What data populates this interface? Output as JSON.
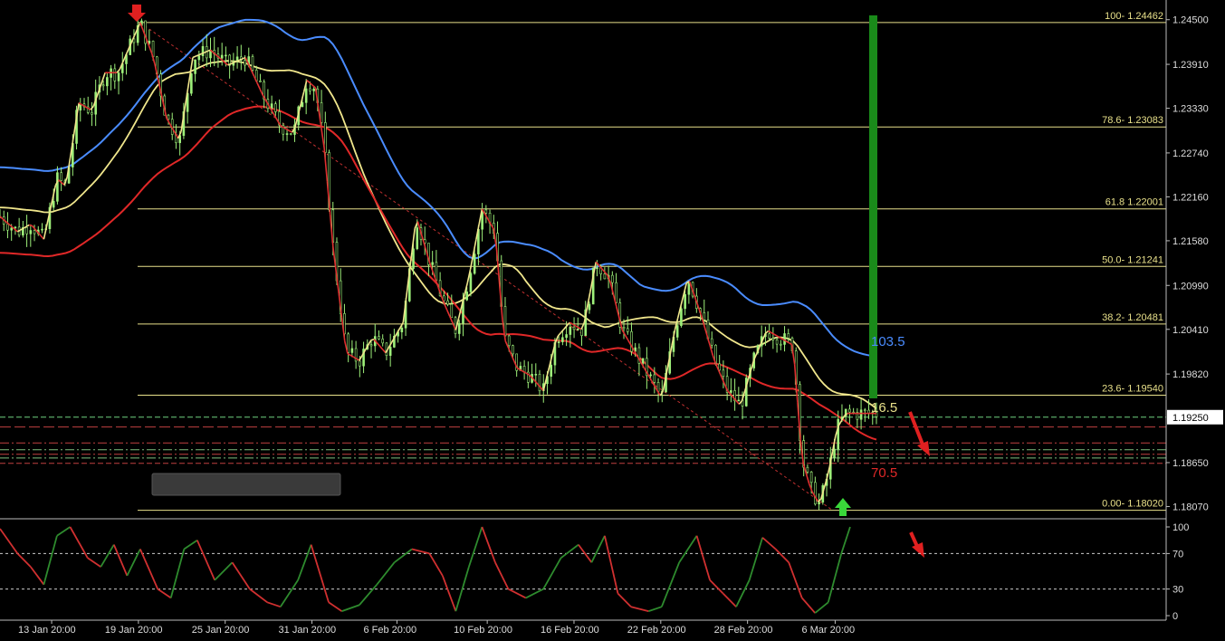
{
  "chart_data": {
    "type": "candlestick",
    "price_axis": {
      "ticks": [
        "1.24500",
        "1.23910",
        "1.23330",
        "1.22740",
        "1.22160",
        "1.21580",
        "1.20990",
        "1.20410",
        "1.19820",
        "1.18650",
        "1.18070"
      ],
      "current_price": "1.19250",
      "range": [
        1.1792,
        1.247
      ]
    },
    "time_axis": {
      "ticks": [
        "13 Jan 20:00",
        "19 Jan 20:00",
        "25 Jan 20:00",
        "31 Jan 20:00",
        "6 Feb 20:00",
        "10 Feb 20:00",
        "16 Feb 20:00",
        "22 Feb 20:00",
        "28 Feb 20:00",
        "6 Mar 20:00"
      ]
    },
    "fibonacci_levels": [
      {
        "label": "100- 1.24462",
        "price": 1.24462
      },
      {
        "label": "78.6- 1.23083",
        "price": 1.23083
      },
      {
        "label": "61.8 1.22001",
        "price": 1.22001
      },
      {
        "label": "50.0- 1.21241",
        "price": 1.21241
      },
      {
        "label": "38.2- 1.20481",
        "price": 1.20481
      },
      {
        "label": "23.6- 1.19540",
        "price": 1.1954
      },
      {
        "label": "0.00- 1.18020",
        "price": 1.1802
      }
    ],
    "moving_average_labels": [
      {
        "text": "103.5",
        "color": "#4a8cff"
      },
      {
        "text": "16.5",
        "color": "#e8e08a"
      },
      {
        "text": "70.5",
        "color": "#e02828"
      }
    ],
    "horizontal_levels": [
      1.1925,
      1.1912,
      1.1891,
      1.1882,
      1.1876,
      1.1871,
      1.1864
    ],
    "price_series_approx": [
      [
        0.0,
        1.219
      ],
      [
        0.02,
        1.217
      ],
      [
        0.035,
        1.218
      ],
      [
        0.05,
        1.216
      ],
      [
        0.065,
        1.224
      ],
      [
        0.075,
        1.223
      ],
      [
        0.09,
        1.234
      ],
      [
        0.105,
        1.233
      ],
      [
        0.12,
        1.238
      ],
      [
        0.135,
        1.238
      ],
      [
        0.15,
        1.242
      ],
      [
        0.16,
        1.2446
      ],
      [
        0.175,
        1.24
      ],
      [
        0.19,
        1.232
      ],
      [
        0.205,
        1.229
      ],
      [
        0.22,
        1.24
      ],
      [
        0.24,
        1.241
      ],
      [
        0.26,
        1.239
      ],
      [
        0.28,
        1.24
      ],
      [
        0.3,
        1.235
      ],
      [
        0.32,
        1.231
      ],
      [
        0.335,
        1.23
      ],
      [
        0.35,
        1.237
      ],
      [
        0.36,
        1.236
      ],
      [
        0.37,
        1.228
      ],
      [
        0.38,
        1.215
      ],
      [
        0.395,
        1.201
      ],
      [
        0.41,
        1.2
      ],
      [
        0.425,
        1.203
      ],
      [
        0.44,
        1.201
      ],
      [
        0.46,
        1.205
      ],
      [
        0.475,
        1.219
      ],
      [
        0.49,
        1.213
      ],
      [
        0.505,
        1.208
      ],
      [
        0.52,
        1.204
      ],
      [
        0.535,
        1.211
      ],
      [
        0.55,
        1.22
      ],
      [
        0.565,
        1.217
      ],
      [
        0.575,
        1.203
      ],
      [
        0.59,
        1.199
      ],
      [
        0.605,
        1.198
      ],
      [
        0.62,
        1.196
      ],
      [
        0.635,
        1.203
      ],
      [
        0.65,
        1.205
      ],
      [
        0.665,
        1.204
      ],
      [
        0.68,
        1.213
      ],
      [
        0.695,
        1.211
      ],
      [
        0.71,
        1.204
      ],
      [
        0.725,
        1.201
      ],
      [
        0.74,
        1.198
      ],
      [
        0.755,
        1.195
      ],
      [
        0.77,
        1.204
      ],
      [
        0.785,
        1.211
      ],
      [
        0.8,
        1.206
      ],
      [
        0.815,
        1.2
      ],
      [
        0.83,
        1.196
      ],
      [
        0.845,
        1.194
      ],
      [
        0.86,
        1.2
      ],
      [
        0.875,
        1.204
      ],
      [
        0.89,
        1.203
      ],
      [
        0.905,
        1.202
      ],
      [
        0.915,
        1.187
      ],
      [
        0.925,
        1.183
      ],
      [
        0.935,
        1.181
      ],
      [
        0.945,
        1.185
      ],
      [
        0.955,
        1.191
      ],
      [
        0.965,
        1.193
      ]
    ],
    "oscillator": {
      "ticks": [
        "100",
        "70",
        "30",
        "0"
      ],
      "levels": [
        70,
        30
      ],
      "series_approx": [
        [
          0.0,
          98
        ],
        [
          0.02,
          70
        ],
        [
          0.035,
          55
        ],
        [
          0.05,
          35
        ],
        [
          0.065,
          90
        ],
        [
          0.08,
          100
        ],
        [
          0.1,
          65
        ],
        [
          0.115,
          55
        ],
        [
          0.13,
          80
        ],
        [
          0.145,
          45
        ],
        [
          0.16,
          75
        ],
        [
          0.18,
          30
        ],
        [
          0.195,
          20
        ],
        [
          0.21,
          75
        ],
        [
          0.225,
          85
        ],
        [
          0.245,
          40
        ],
        [
          0.265,
          60
        ],
        [
          0.285,
          30
        ],
        [
          0.305,
          15
        ],
        [
          0.32,
          10
        ],
        [
          0.34,
          40
        ],
        [
          0.355,
          80
        ],
        [
          0.375,
          15
        ],
        [
          0.39,
          5
        ],
        [
          0.41,
          12
        ],
        [
          0.43,
          35
        ],
        [
          0.45,
          60
        ],
        [
          0.47,
          75
        ],
        [
          0.49,
          70
        ],
        [
          0.505,
          45
        ],
        [
          0.52,
          5
        ],
        [
          0.535,
          55
        ],
        [
          0.55,
          100
        ],
        [
          0.565,
          60
        ],
        [
          0.58,
          30
        ],
        [
          0.6,
          20
        ],
        [
          0.62,
          30
        ],
        [
          0.64,
          65
        ],
        [
          0.66,
          80
        ],
        [
          0.675,
          60
        ],
        [
          0.69,
          90
        ],
        [
          0.705,
          25
        ],
        [
          0.72,
          10
        ],
        [
          0.74,
          5
        ],
        [
          0.755,
          10
        ],
        [
          0.775,
          60
        ],
        [
          0.795,
          90
        ],
        [
          0.81,
          40
        ],
        [
          0.825,
          25
        ],
        [
          0.84,
          10
        ],
        [
          0.855,
          40
        ],
        [
          0.87,
          88
        ],
        [
          0.885,
          75
        ],
        [
          0.9,
          60
        ],
        [
          0.915,
          20
        ],
        [
          0.93,
          3
        ],
        [
          0.945,
          15
        ],
        [
          0.96,
          70
        ],
        [
          0.97,
          100
        ]
      ]
    }
  }
}
